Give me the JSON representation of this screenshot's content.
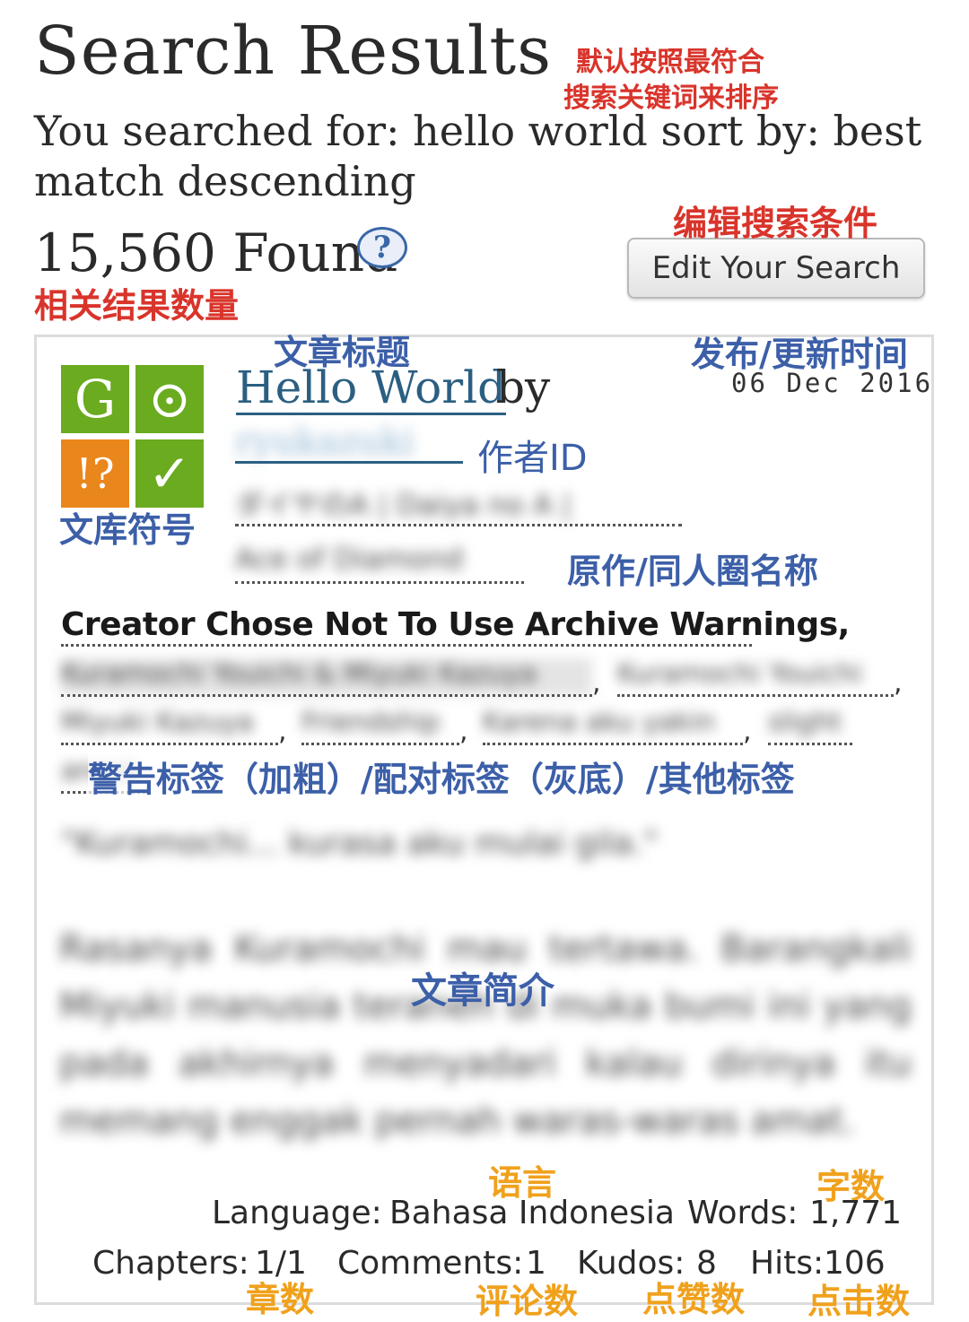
{
  "header": {
    "title": "Search Results",
    "search_summary": "You searched for: hello world sort by: best match descending",
    "found_count": "15,560 Found",
    "help_glyph": "?",
    "edit_search_label": "Edit Your Search"
  },
  "work": {
    "symbols": [
      {
        "name": "rating",
        "glyph": "G",
        "color": "#6aab1f"
      },
      {
        "name": "category",
        "glyph": "⊙",
        "color": "#6aab1f"
      },
      {
        "name": "warning",
        "glyph": "!?",
        "color": "#e9861c"
      },
      {
        "name": "complete",
        "glyph": "✓",
        "color": "#6aab1f"
      }
    ],
    "title": "Hello World",
    "by": "by",
    "author": "ryukazuki",
    "date": "06 Dec 2016",
    "fandoms": [
      "ダイヤのA | Daiya no A |",
      "Ace of Diamond"
    ],
    "warning": "Creator Chose Not To Use Archive Warnings,",
    "tags": [
      "Kuramochi Youichi & Miyuki Kazuya",
      "Kuramochi Youichi",
      "Miyuki Kazuya",
      "Friendship",
      "Karena aku yakin",
      "slight",
      "angst"
    ],
    "quote": "\"Kuramochi... kurasa aku mulai gila.\"",
    "summary": "Rasanya Kuramochi mau tertawa. Barangkali Miyuki manusia teraneh di muka bumi ini yang pada akhirnya menyadari kalau dirinya itu memang enggak pernah waras-waras amat.",
    "stats": {
      "language_label": "Language:",
      "language": "Bahasa Indonesia",
      "words_label": "Words:",
      "words": "1,771",
      "chapters_label": "Chapters:",
      "chapters": "1/1",
      "comments_label": "Comments:",
      "comments": "1",
      "kudos_label": "Kudos:",
      "kudos": "8",
      "hits_label": "Hits:",
      "hits": "106"
    }
  },
  "annotations": {
    "sort_note_line1": "默认按照最符合",
    "sort_note_line2": "搜索关键词来排序",
    "edit_note": "编辑搜索条件",
    "count_note": "相关结果数量",
    "title_note": "文章标题",
    "date_note": "发布/更新时间",
    "author_note": "作者ID",
    "symbols_note": "文库符号",
    "fandom_note": "原作/同人圈名称",
    "tags_note": "警告标签（加粗）/配对标签（灰底）/其他标签",
    "summary_note": "文章简介",
    "language_note": "语言",
    "words_note": "字数",
    "chapters_note": "章数",
    "comments_note": "评论数",
    "kudos_note": "点赞数",
    "hits_note": "点击数"
  }
}
